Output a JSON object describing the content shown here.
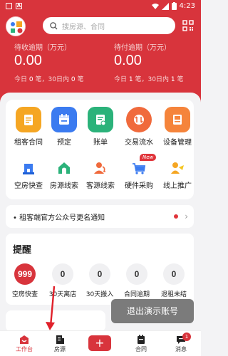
{
  "status_bar": {
    "time": "4:23"
  },
  "search": {
    "placeholder": "搜房源、合同"
  },
  "stats": {
    "receivable": {
      "label": "待收逾期（万元）",
      "value": "0.00",
      "today_prefix": "今日",
      "today_count": "0",
      "today_unit": "笔，30日内",
      "month_count": "0",
      "month_unit": "笔"
    },
    "payable": {
      "label": "待付逾期（万元）",
      "value": "0.00",
      "today_prefix": "今日",
      "today_count": "1",
      "today_unit": "笔，30日内",
      "month_count": "1",
      "month_unit": "笔"
    }
  },
  "grid": {
    "row1": [
      {
        "label": "租客合同",
        "icon": "contract-icon",
        "color": "#f5a623"
      },
      {
        "label": "预定",
        "icon": "calendar-icon",
        "color": "#3b7bf0"
      },
      {
        "label": "账单",
        "icon": "bill-icon",
        "color": "#2bb27a"
      },
      {
        "label": "交易流水",
        "icon": "transaction-icon",
        "color": "#f06a3c"
      },
      {
        "label": "设备管理",
        "icon": "device-icon",
        "color": "#f5843b"
      }
    ],
    "row2": [
      {
        "label": "空房快查",
        "icon": "building-icon",
        "color": "#3b7bf0"
      },
      {
        "label": "房源线索",
        "icon": "house-lead-icon",
        "color": "#2bb27a"
      },
      {
        "label": "客源线索",
        "icon": "customer-lead-icon",
        "color": "#f06a3c"
      },
      {
        "label": "硬件采购",
        "icon": "cart-icon",
        "color": "#3b7bf0"
      },
      {
        "label": "线上推广",
        "icon": "promotion-icon",
        "color": "#f5a623"
      }
    ],
    "new_badge": "New"
  },
  "notice": {
    "text": "• 租客端官方公众号更名通知"
  },
  "reminders": {
    "title": "提醒",
    "items": [
      {
        "count": "999",
        "label": "空房快查"
      },
      {
        "count": "0",
        "label": "30天离店"
      },
      {
        "count": "0",
        "label": "30天搬入"
      },
      {
        "count": "0",
        "label": "合同逾期"
      },
      {
        "count": "0",
        "label": "退租未结"
      }
    ]
  },
  "exit_demo": "退出演示账号",
  "tabbar": {
    "items": [
      {
        "label": "工作台",
        "icon": "workbench-icon"
      },
      {
        "label": "房源",
        "icon": "house-icon"
      },
      {
        "label": "",
        "icon": "plus-icon"
      },
      {
        "label": "合同",
        "icon": "contract-tab-icon"
      },
      {
        "label": "消息",
        "icon": "message-icon"
      }
    ],
    "message_badge": "1",
    "add_symbol": "+"
  },
  "colors": {
    "primary_red": "#d8343c",
    "background": "#f3f3f5"
  }
}
